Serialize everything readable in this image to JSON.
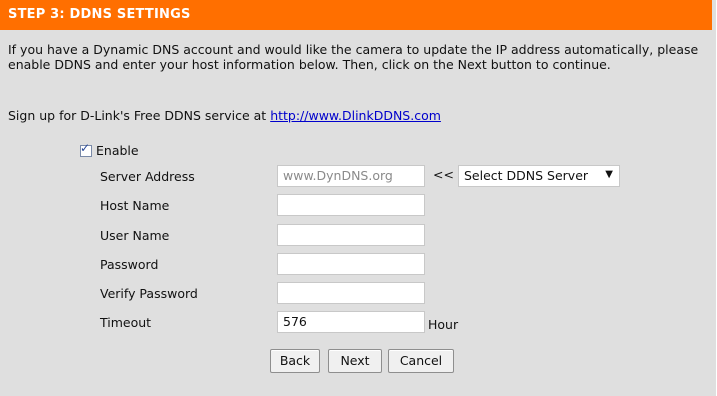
{
  "header": {
    "title": "STEP 3: DDNS SETTINGS"
  },
  "intro": {
    "text": "If you have a Dynamic DNS account and would like the camera to update the IP address automatically, please enable DDNS and enter your host information below. Then, click on the Next button to continue."
  },
  "signup": {
    "prefix": "Sign up for D-Link's Free DDNS service at ",
    "link_text": "http://www.DlinkDDNS.com"
  },
  "enable": {
    "label": "Enable",
    "checked": true
  },
  "fields": {
    "server_address": {
      "label": "Server Address",
      "value": "www.DynDNS.org"
    },
    "host_name": {
      "label": "Host Name",
      "value": ""
    },
    "user_name": {
      "label": "User Name",
      "value": ""
    },
    "password": {
      "label": "Password",
      "value": ""
    },
    "verify_password": {
      "label": "Verify Password",
      "value": ""
    },
    "timeout": {
      "label": "Timeout",
      "value": "576",
      "unit": "Hour"
    }
  },
  "server_select": {
    "arrows": "<<",
    "selected": "Select DDNS Server"
  },
  "buttons": {
    "back": "Back",
    "next": "Next",
    "cancel": "Cancel"
  },
  "colors": {
    "header_bg": "#ff6f00",
    "panel_bg": "#dfdfdf",
    "link": "#0000cc"
  }
}
